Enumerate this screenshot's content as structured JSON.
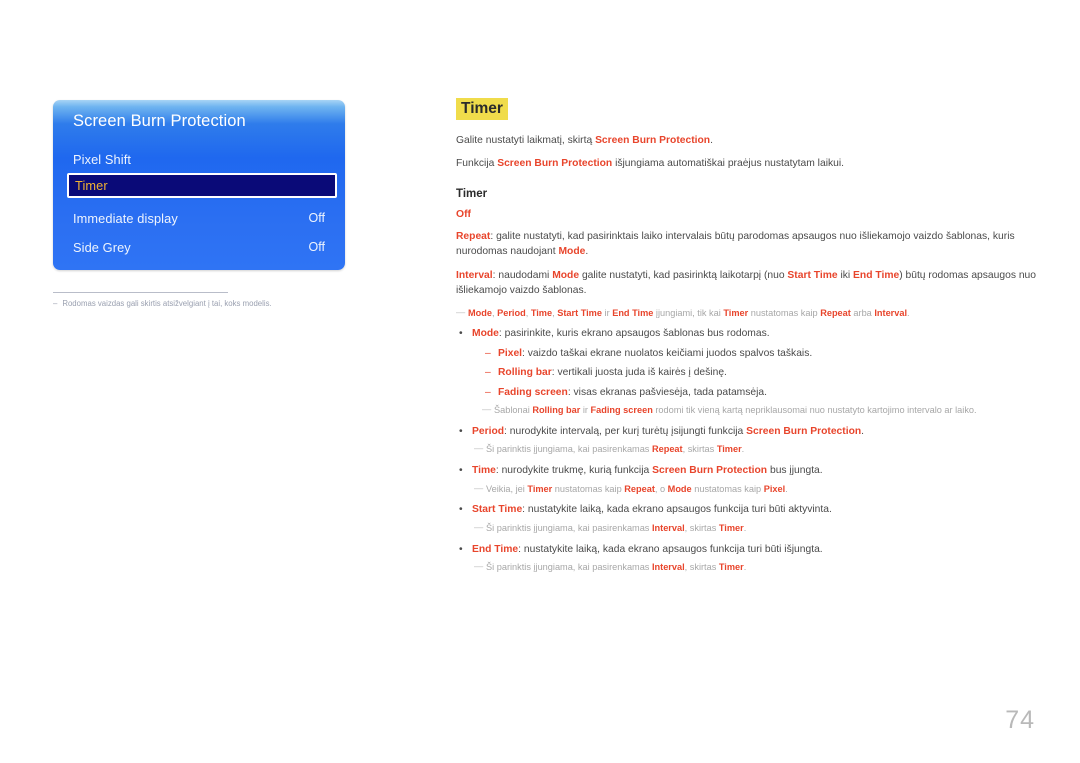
{
  "osd_menu": {
    "title": "Screen Burn Protection",
    "colors": {
      "selected_bg": "#0a0a78",
      "selected_text": "#f2b233",
      "panel_blue": "#1f68ef"
    },
    "items": [
      {
        "label": "Pixel Shift",
        "value": ""
      },
      {
        "label": "Timer",
        "value": "",
        "selected": true
      },
      {
        "label": "Immediate display",
        "value": "Off"
      },
      {
        "label": "Side Grey",
        "value": "Off"
      }
    ]
  },
  "menu_footnote": {
    "dash": "–",
    "text": "Rodomas vaizdas gali skirtis atsižvelgiant į tai, koks modelis."
  },
  "content": {
    "heading": "Timer",
    "heading_highlight_color": "#f0dc4b",
    "intro": [
      {
        "pre": "Galite nustatyti laikmatį, skirtą ",
        "kw": "Screen Burn Protection",
        "post": "."
      },
      {
        "pre": "Funkcija ",
        "kw": "Screen Burn Protection",
        "post": " išjungiama automatiškai praėjus nustatytam laikui."
      }
    ],
    "sub_heading": "Timer",
    "option_off": "Off",
    "repeat": {
      "kw": "Repeat",
      "t1": ": galite nustatyti, kad pasirinktais laiko intervalais būtų parodomas apsaugos nuo išliekamojo vaizdo šablonas, kuris nurodomas naudojant ",
      "kw2": "Mode",
      "t2": "."
    },
    "interval": {
      "kw": "Interval",
      "t1": ": naudodami ",
      "kw2": "Mode",
      "t2": " galite nustatyti, kad pasirinktą laikotarpį (nuo ",
      "kw3": "Start Time",
      "t3": " iki ",
      "kw4": "End Time",
      "t4": ") būtų rodomas apsaugos nuo išliekamojo vaizdo šablonas."
    },
    "note_modes": {
      "k1": "Mode",
      "s1": ", ",
      "k2": "Period",
      "s2": ", ",
      "k3": "Time",
      "s3": ", ",
      "k4": "Start Time",
      "s4": " ir ",
      "k5": "End Time",
      "s5": " įjungiami, tik kai ",
      "k6": "Timer",
      "s6": " nustatomas kaip ",
      "k7": "Repeat",
      "s7": " arba ",
      "k8": "Interval",
      "s8": "."
    },
    "bullets": [
      {
        "mark": "•",
        "kw": "Mode",
        "text": ": pasirinkite, kuris ekrano apsaugos šablonas bus rodomas."
      },
      {
        "mark": "–",
        "level": 2,
        "kw": "Pixel",
        "text": ": vaizdo taškai ekrane nuolatos keičiami juodos spalvos taškais."
      },
      {
        "mark": "–",
        "level": 2,
        "kw": "Rolling bar",
        "text": ": vertikali juosta juda iš kairės į dešinę."
      },
      {
        "mark": "–",
        "level": 2,
        "kw": "Fading screen",
        "text": ": visas ekranas pašviesėja, tada patamsėja."
      }
    ],
    "note_patterns": {
      "p1": "Šablonai ",
      "k1": "Rolling bar",
      "p2": " ir ",
      "k2": "Fading screen",
      "p3": " rodomi tik vieną kartą nepriklausomai nuo nustatyto kartojimo intervalo ar laiko."
    },
    "period": {
      "mark": "•",
      "kw": "Period",
      "t1": ": nurodykite intervalą, per kurį turėtų įsijungti funkcija ",
      "kw2": "Screen Burn Protection",
      "t2": "."
    },
    "note_period": {
      "p1": "Ši parinktis įjungiama, kai pasirenkamas ",
      "k1": "Repeat",
      "p2": ", skirtas ",
      "k2": "Timer",
      "p3": "."
    },
    "time": {
      "mark": "•",
      "kw": "Time",
      "t1": ": nurodykite trukmę, kurią funkcija ",
      "kw2": "Screen Burn Protection",
      "t2": " bus įjungta."
    },
    "note_time": {
      "p1": "Veikia, jei ",
      "k1": "Timer",
      "p2": " nustatomas kaip ",
      "k2": "Repeat",
      "p3": ", o ",
      "k3": "Mode",
      "p4": " nustatomas kaip ",
      "k4": "Pixel",
      "p5": "."
    },
    "start_time": {
      "mark": "•",
      "kw": "Start Time",
      "t1": ": nustatykite laiką, kada ekrano apsaugos funkcija turi būti aktyvinta."
    },
    "note_start": {
      "p1": "Ši parinktis įjungiama, kai pasirenkamas ",
      "k1": "Interval",
      "p2": ", skirtas ",
      "k2": "Timer",
      "p3": "."
    },
    "end_time": {
      "mark": "•",
      "kw": "End Time",
      "t1": ": nustatykite laiką, kada ekrano apsaugos funkcija turi būti išjungta."
    },
    "note_end": {
      "p1": "Ši parinktis įjungiama, kai pasirenkamas ",
      "k1": "Interval",
      "p2": ", skirtas ",
      "k2": "Timer",
      "p3": "."
    }
  },
  "page_number": "74"
}
